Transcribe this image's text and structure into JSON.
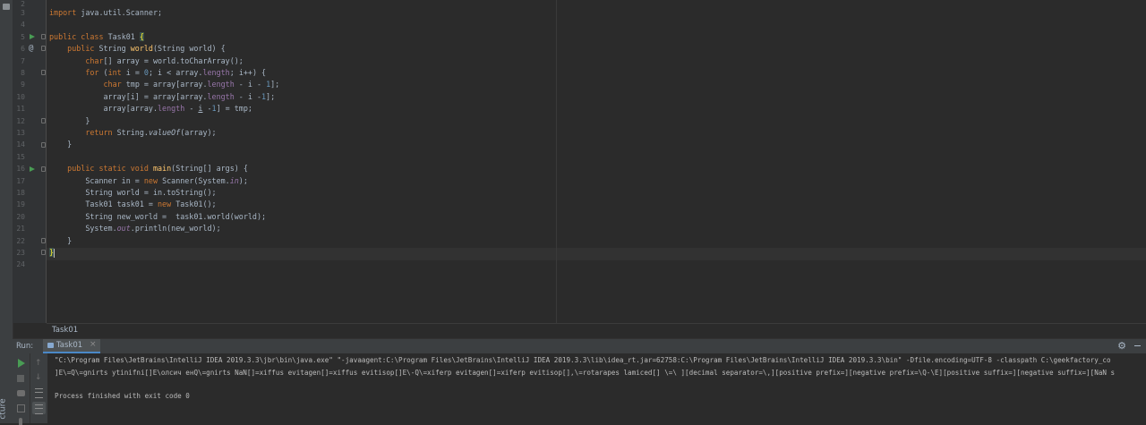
{
  "tool_strip": {
    "label": "cture"
  },
  "editor": {
    "file_name": "Task01",
    "lines": [
      {
        "no": "2",
        "text": ""
      },
      {
        "no": "3",
        "text": "import java.util.Scanner;"
      },
      {
        "no": "4",
        "text": ""
      },
      {
        "no": "5",
        "text": "public class Task01 {"
      },
      {
        "no": "6",
        "text": "    public String world(String world) {"
      },
      {
        "no": "7",
        "text": "        char[] array = world.toCharArray();"
      },
      {
        "no": "8",
        "text": "        for (int i = 0; i < array.length; i++) {"
      },
      {
        "no": "9",
        "text": "            char tmp = array[array.length - i - 1];"
      },
      {
        "no": "10",
        "text": "            array[i] = array[array.length - i -1];"
      },
      {
        "no": "11",
        "text": "            array[array.length - i -1] = tmp;"
      },
      {
        "no": "12",
        "text": "        }"
      },
      {
        "no": "13",
        "text": "        return String.valueOf(array);"
      },
      {
        "no": "14",
        "text": "    }"
      },
      {
        "no": "15",
        "text": ""
      },
      {
        "no": "16",
        "text": "    public static void main(String[] args) {"
      },
      {
        "no": "17",
        "text": "        Scanner in = new Scanner(System.in);"
      },
      {
        "no": "18",
        "text": "        String world = in.toString();"
      },
      {
        "no": "19",
        "text": "        Task01 task01 = new Task01();"
      },
      {
        "no": "20",
        "text": "        String new_world =  task01.world(world);"
      },
      {
        "no": "21",
        "text": "        System.out.println(new_world);"
      },
      {
        "no": "22",
        "text": "    }"
      },
      {
        "no": "23",
        "text": "}"
      },
      {
        "no": "24",
        "text": ""
      }
    ]
  },
  "run_panel": {
    "title": "Run:",
    "tab_label": "Task01",
    "tab_close": "×",
    "console_lines": [
      "\"C:\\Program Files\\JetBrains\\IntelliJ IDEA 2019.3.3\\jbr\\bin\\java.exe\" \"-javaagent:C:\\Program Files\\JetBrains\\IntelliJ IDEA 2019.3.3\\lib\\idea_rt.jar=62758:C:\\Program Files\\JetBrains\\IntelliJ IDEA 2019.3.3\\bin\" -Dfile.encoding=UTF-8 -classpath C:\\geekfactory_co",
      "]E\\=Q\\=gnirts ytinifni[]E\\олсич енQ\\=gnirts NaN[]=xiffus evitagen[]=xiffus evitisop[]E\\-Q\\=xiferp evitagen[]=xiferp evitisop[],\\=rotarapes lamiced[] \\=\\ ][decimal separator=\\,][positive prefix=][negative prefix=\\Q-\\E][positive suffix=][negative suffix=][NaN s",
      "",
      "Process finished with exit code 0"
    ]
  },
  "colors": {
    "background": "#2b2b2b",
    "keyword": "#cc7832",
    "method": "#ffc66d",
    "number": "#6897bb",
    "field": "#9876aa",
    "text": "#a9b7c6",
    "run_green": "#499c54"
  }
}
